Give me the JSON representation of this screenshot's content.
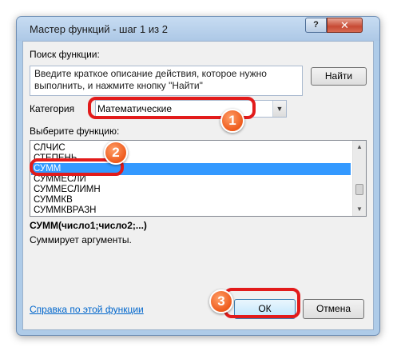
{
  "window": {
    "title": "Мастер функций - шаг 1 из 2",
    "help_label": "?",
    "close_label": "✕"
  },
  "search": {
    "label": "Поиск функции:",
    "description": "Введите краткое описание действия, которое нужно выполнить, и нажмите кнопку \"Найти\"",
    "find_button": "Найти"
  },
  "category": {
    "label": "Категория",
    "selected": "Математические"
  },
  "function_list": {
    "label": "Выберите функцию:",
    "items": [
      "СЛЧИС",
      "СТЕПЕНЬ",
      "СУММ",
      "СУММЕСЛИ",
      "СУММЕСЛИМН",
      "СУММКВ",
      "СУММКВРАЗН"
    ],
    "selected_index": 2
  },
  "details": {
    "signature": "СУММ(число1;число2;...)",
    "description": "Суммирует аргументы."
  },
  "footer": {
    "help_link": "Справка по этой функции",
    "ok_label": "ОК",
    "cancel_label": "Отмена"
  },
  "annotations": {
    "badge_1": "1",
    "badge_2": "2",
    "badge_3": "3",
    "highlight_color": "#e21b1b",
    "badge_color": "#ee5a1c"
  }
}
